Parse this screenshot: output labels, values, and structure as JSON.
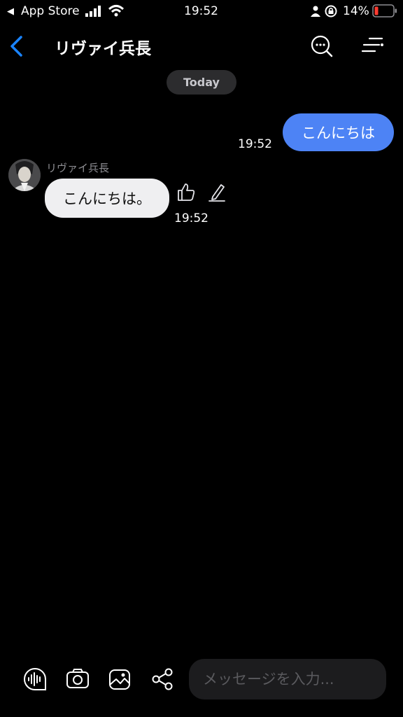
{
  "status_bar": {
    "back_app": "App Store",
    "time": "19:52",
    "battery": "14%"
  },
  "header": {
    "title": "リヴァイ兵長"
  },
  "chat": {
    "date_label": "Today",
    "messages": [
      {
        "direction": "outgoing",
        "text": "こんにちは",
        "time": "19:52"
      },
      {
        "direction": "incoming",
        "sender": "リヴァイ兵長",
        "text": "こんにちは。",
        "time": "19:52"
      }
    ]
  },
  "composer": {
    "placeholder": "メッセージを入力..."
  },
  "icons": {
    "back": "chevron-left-icon",
    "search": "search-chat-icon",
    "menu": "filter-menu-icon",
    "like": "thumbs-up-icon",
    "edit": "pencil-icon",
    "voice": "voice-wave-icon",
    "camera": "camera-icon",
    "gallery": "gallery-icon",
    "share": "share-icon"
  },
  "colors": {
    "accent": "#1a84ff",
    "outgoing_bubble": "#4d83f5",
    "incoming_bubble": "#efeff1",
    "battery_low": "#ff3b30"
  }
}
